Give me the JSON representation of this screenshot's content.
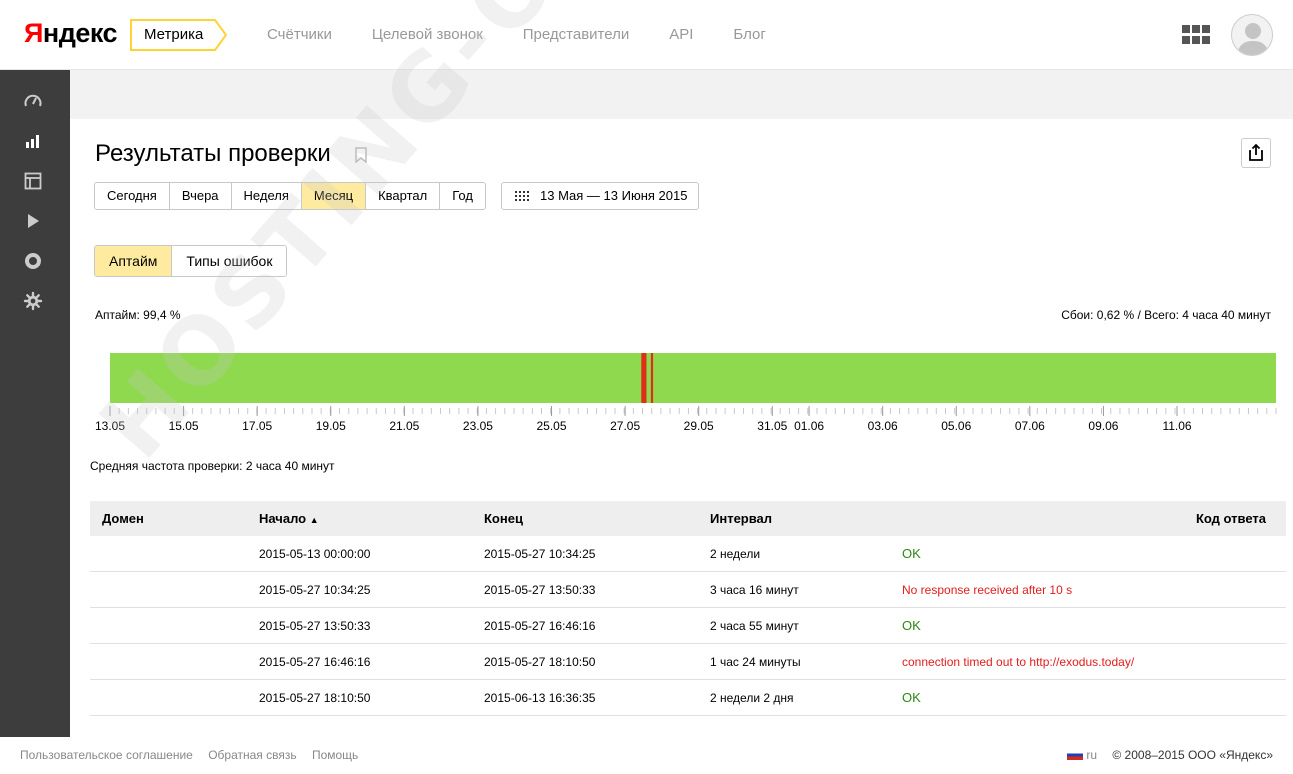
{
  "header": {
    "logo_first": "Я",
    "logo_rest": "ндекс",
    "product": "Метрика",
    "nav": [
      "Счётчики",
      "Целевой звонок",
      "Представители",
      "API",
      "Блог"
    ]
  },
  "page": {
    "title": "Результаты проверки",
    "periods": [
      {
        "label": "Сегодня",
        "active": false
      },
      {
        "label": "Вчера",
        "active": false
      },
      {
        "label": "Неделя",
        "active": false
      },
      {
        "label": "Месяц",
        "active": true
      },
      {
        "label": "Квартал",
        "active": false
      },
      {
        "label": "Год",
        "active": false
      }
    ],
    "date_range": "13 Мая — 13 Июня 2015",
    "views": [
      {
        "label": "Аптайм",
        "active": true
      },
      {
        "label": "Типы ошибок",
        "active": false
      }
    ],
    "uptime_label": "Аптайм: 99,4 %",
    "fail_label": "Сбои: 0,62 % / Всего: 4 часа 40 минут",
    "avg_freq": "Средняя частота проверки: 2 часа 40 минут"
  },
  "timeline": {
    "start": "2015-05-13 00:00:00",
    "end": "2015-06-13 16:36:35",
    "days_total": 31.69,
    "ok_color": "#8fd94f",
    "fail_color": "#e22d1b",
    "failures": [
      {
        "from_day": 14.44,
        "to_day": 14.58
      },
      {
        "from_day": 14.7,
        "to_day": 14.76
      }
    ],
    "tick_labels": [
      "13.05",
      "15.05",
      "17.05",
      "19.05",
      "21.05",
      "23.05",
      "25.05",
      "27.05",
      "29.05",
      "31.05",
      "01.06",
      "03.06",
      "05.06",
      "07.06",
      "09.06",
      "11.06"
    ],
    "tick_days": [
      0,
      2,
      4,
      6,
      8,
      10,
      12,
      14,
      16,
      18,
      19,
      21,
      23,
      25,
      27,
      29
    ]
  },
  "table": {
    "headers": {
      "domain": "Домен",
      "start": "Начало",
      "sort_arrow": "▲",
      "end": "Конец",
      "interval": "Интервал",
      "code": "Код ответа"
    },
    "rows": [
      {
        "start": "2015-05-13 00:00:00",
        "end": "2015-05-27 10:34:25",
        "interval": "2 недели",
        "status": "OK",
        "ok": true
      },
      {
        "start": "2015-05-27 10:34:25",
        "end": "2015-05-27 13:50:33",
        "interval": "3 часа 16 минут",
        "status": "No response received after 10 s",
        "ok": false
      },
      {
        "start": "2015-05-27 13:50:33",
        "end": "2015-05-27 16:46:16",
        "interval": "2 часа 55 минут",
        "status": "OK",
        "ok": true
      },
      {
        "start": "2015-05-27 16:46:16",
        "end": "2015-05-27 18:10:50",
        "interval": "1 час 24 минуты",
        "status": "connection timed out to http://exodus.today/",
        "ok": false
      },
      {
        "start": "2015-05-27 18:10:50",
        "end": "2015-06-13 16:36:35",
        "interval": "2 недели 2 дня",
        "status": "OK",
        "ok": true
      }
    ]
  },
  "footer": {
    "links": [
      "Пользовательское соглашение",
      "Обратная связь",
      "Помощь"
    ],
    "lang": "ru",
    "copyright": "© 2008–2015  ООО «Яндекс»"
  },
  "watermark": "HOSTING-OBZOR.RU"
}
